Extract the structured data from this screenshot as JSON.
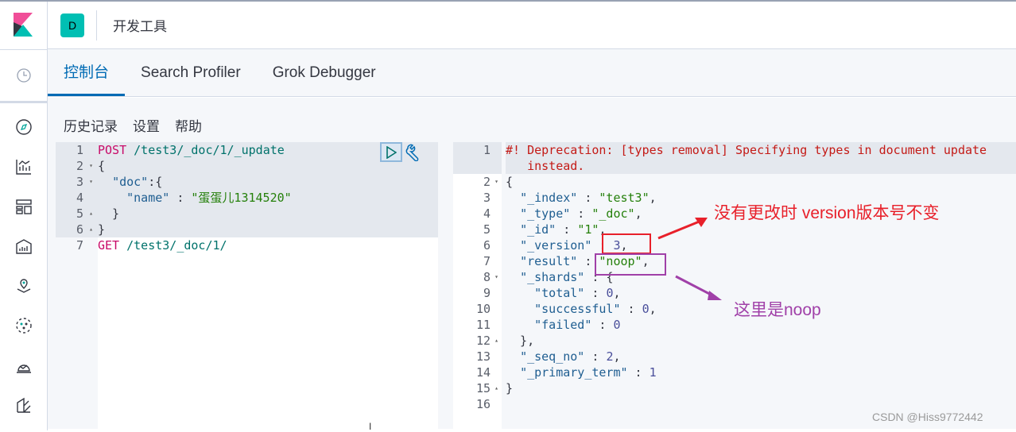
{
  "header": {
    "space_initial": "D",
    "title": "开发工具"
  },
  "tabs": [
    {
      "label": "控制台",
      "active": true
    },
    {
      "label": "Search Profiler"
    },
    {
      "label": "Grok Debugger"
    }
  ],
  "toolbar": {
    "history": "历史记录",
    "settings": "设置",
    "help": "帮助"
  },
  "nav_icons": [
    "clock-icon",
    "compass-icon",
    "visualize-icon",
    "dashboard-icon",
    "canvas-icon",
    "maps-icon",
    "ml-icon",
    "uptime-icon",
    "apm-icon"
  ],
  "request": {
    "lines": [
      [
        [
          "k",
          "POST"
        ],
        [
          "pl",
          " "
        ],
        [
          "p",
          "/test3/_doc/1/_update"
        ]
      ],
      [
        [
          "pl",
          "{"
        ]
      ],
      [
        [
          "pl",
          "  "
        ],
        [
          "key",
          "\"doc\""
        ],
        [
          "pl",
          ":{"
        ]
      ],
      [
        [
          "pl",
          "    "
        ],
        [
          "key",
          "\"name\""
        ],
        [
          "pl",
          " : "
        ],
        [
          "s",
          "\"蛋蛋儿1314520\""
        ]
      ],
      [
        [
          "pl",
          "  }"
        ]
      ],
      [
        [
          "pl",
          "}"
        ]
      ],
      [
        [
          "k",
          "GET"
        ],
        [
          "pl",
          " "
        ],
        [
          "p",
          "/test3/_doc/1/"
        ]
      ]
    ],
    "folds": [
      "",
      "▾",
      "▾",
      "",
      "▴",
      "▴",
      ""
    ]
  },
  "response": {
    "lines": [
      [
        [
          "d",
          "#! Deprecation: [types removal] Specifying types in document update"
        ]
      ],
      [
        [
          "d",
          "   instead."
        ]
      ],
      [
        [
          "pl",
          "{"
        ]
      ],
      [
        [
          "pl",
          "  "
        ],
        [
          "key",
          "\"_index\""
        ],
        [
          "pl",
          " : "
        ],
        [
          "s",
          "\"test3\""
        ],
        [
          "pl",
          ","
        ]
      ],
      [
        [
          "pl",
          "  "
        ],
        [
          "key",
          "\"_type\""
        ],
        [
          "pl",
          " : "
        ],
        [
          "s",
          "\"_doc\""
        ],
        [
          "pl",
          ","
        ]
      ],
      [
        [
          "pl",
          "  "
        ],
        [
          "key",
          "\"_id\""
        ],
        [
          "pl",
          " : "
        ],
        [
          "s",
          "\"1\""
        ],
        [
          "pl",
          ","
        ]
      ],
      [
        [
          "pl",
          "  "
        ],
        [
          "key",
          "\"_version\""
        ],
        [
          "pl",
          " : "
        ],
        [
          "n",
          "3"
        ],
        [
          "pl",
          ","
        ]
      ],
      [
        [
          "pl",
          "  "
        ],
        [
          "key",
          "\"result\""
        ],
        [
          "pl",
          " : "
        ],
        [
          "s",
          "\"noop\""
        ],
        [
          "pl",
          ","
        ]
      ],
      [
        [
          "pl",
          "  "
        ],
        [
          "key",
          "\"_shards\""
        ],
        [
          "pl",
          " : {"
        ]
      ],
      [
        [
          "pl",
          "    "
        ],
        [
          "key",
          "\"total\""
        ],
        [
          "pl",
          " : "
        ],
        [
          "n",
          "0"
        ],
        [
          "pl",
          ","
        ]
      ],
      [
        [
          "pl",
          "    "
        ],
        [
          "key",
          "\"successful\""
        ],
        [
          "pl",
          " : "
        ],
        [
          "n",
          "0"
        ],
        [
          "pl",
          ","
        ]
      ],
      [
        [
          "pl",
          "    "
        ],
        [
          "key",
          "\"failed\""
        ],
        [
          "pl",
          " : "
        ],
        [
          "n",
          "0"
        ]
      ],
      [
        [
          "pl",
          "  },"
        ]
      ],
      [
        [
          "pl",
          "  "
        ],
        [
          "key",
          "\"_seq_no\""
        ],
        [
          "pl",
          " : "
        ],
        [
          "n",
          "2"
        ],
        [
          "pl",
          ","
        ]
      ],
      [
        [
          "pl",
          "  "
        ],
        [
          "key",
          "\"_primary_term\""
        ],
        [
          "pl",
          " : "
        ],
        [
          "n",
          "1"
        ]
      ],
      [
        [
          "pl",
          "}"
        ]
      ],
      [
        [
          "pl",
          ""
        ]
      ]
    ],
    "numbers": [
      "1",
      "",
      "2",
      "3",
      "4",
      "5",
      "6",
      "7",
      "8",
      "9",
      "10",
      "11",
      "12",
      "13",
      "14",
      "15",
      "16"
    ],
    "folds": [
      "",
      "",
      "▾",
      "",
      "",
      "",
      "",
      "",
      "▾",
      "",
      "",
      "",
      "▴",
      "",
      "",
      "▴",
      ""
    ]
  },
  "annotations": {
    "version_note": "没有更改时 version版本号不变",
    "noop_note": "这里是noop",
    "version_color": "#e8202a",
    "noop_color": "#a040a8"
  },
  "watermark": "CSDN @Hiss9772442"
}
